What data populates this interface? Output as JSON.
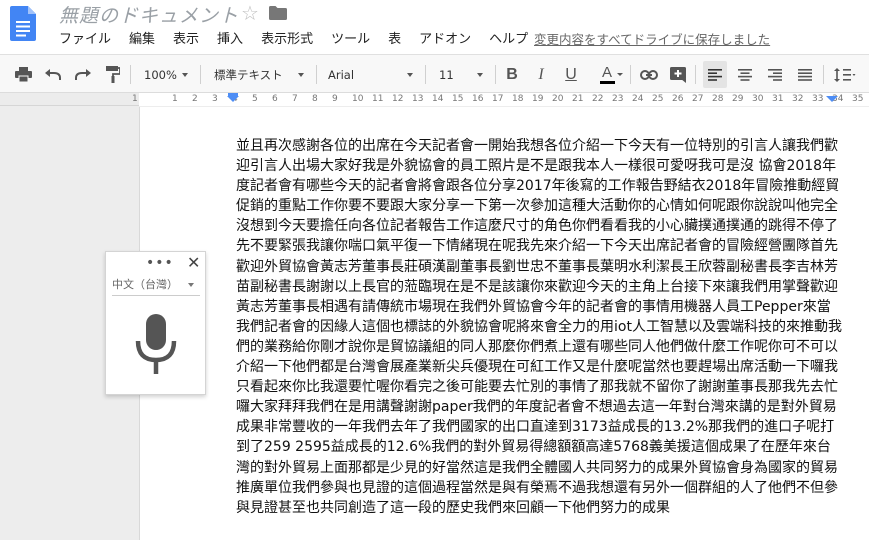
{
  "header": {
    "title": "無題のドキュメント",
    "save_link": "変更内容をすべてドライブに保存しました",
    "doc_icon": "google-docs-icon",
    "star_icon": "star-icon",
    "folder_icon": "folder-icon"
  },
  "menu": [
    "ファイル",
    "編集",
    "表示",
    "挿入",
    "表示形式",
    "ツール",
    "表",
    "アドオン",
    "ヘルプ"
  ],
  "toolbar": {
    "zoom": "100%",
    "style": "標準テキスト",
    "font": "Arial",
    "size": "11",
    "bold": "B",
    "italic": "I",
    "underline": "U",
    "text_color": "A"
  },
  "ruler": {
    "numbers": [
      "1",
      "",
      "1",
      "2",
      "3",
      "4",
      "5",
      "6",
      "7",
      "8",
      "9",
      "10",
      "11",
      "12",
      "13",
      "14",
      "15",
      "16",
      "17",
      "18",
      "19",
      "20",
      "21",
      "22",
      "23",
      "24",
      "25",
      "26",
      "27",
      "28",
      "29",
      "30",
      "31",
      "32",
      "33",
      "34",
      "35"
    ]
  },
  "document": {
    "body": "並且再次感謝各位的出席在今天記者會一開始我想各位介紹一下今天有一位特別的引言人讓我們歡迎引言人出場大家好我是外貌協會的員工照片是不是跟我本人一樣很可愛呀我可是沒 協會2018年度記者會有哪些今天的記者會將會跟各位分享2017年後寫的工作報告野結衣2018年冒險推動經貿促銷的重點工作你要不要跟大家分享一下第一次參加這種大活動你的心情如何呢跟你說說叫他完全沒想到今天要擔任向各位記者報告工作這麼尺寸的角色你們看看我的小心臟撲通撲通的跳得不停了先不要緊張我讓你喘口氣平復一下情緒現在呢我先來介紹一下今天出席記者會的冒險經營團隊首先歡迎外貿協會黃志芳董事長莊碩漢副董事長劉世忠不董事長葉明水利潔長王欣蓉副秘書長李吉林芳苗副秘書長謝謝以上長官的蒞臨現在是不是該讓你來歡迎今天的主角上台接下來讓我們用掌聲歡迎黃志芳董事長相遇有請傳統市場現在我們外貿協會今年的記者會的事情用機器人員工Pepper來當我們記者會的因緣人這個也標誌的外貌協會呢將來會全力的用iot人工智慧以及雲端科技的來推動我們的業務給你剛才說你是貿協議組的同人那麼你們煮上還有哪些同人他們做什麼工作呢你可不可以介紹一下他們都是台灣會展產業新尖兵優現在可紅工作又是什麼呢當然也要趕場出席活動一下囉我只看起來你比我還要忙喔你看完之後可能要去忙別的事情了那我就不留你了謝謝董事長那我先去忙囉大家拜拜我們在是用講聲謝謝paper我們的年度記者會不想過去這一年對台灣來講的是對外貿易成果非常豐收的一年我們去年了我們國家的出口直達到3173益成長的13.2%那我們的進口子呢打到了259 2595益成長的12.6%我們的對外貿易得總額額高達5768義美援這個成果了在歷年來台灣的對外貿易上面那都是少見的好當然這是我們全體國人共同努力的成果外貿協會身為國家的貿易推廣單位我們參與也見證的這個過程當然是與有榮焉不過我想還有另外一個群組的人了他們不但參與見證甚至也共同創造了這一段的歷史我們來回顧一下他們努力的成果"
  },
  "voice_typing": {
    "language": "中文（台灣）",
    "menu_dots": "•••",
    "close": "✕",
    "mic_icon": "microphone-icon"
  }
}
